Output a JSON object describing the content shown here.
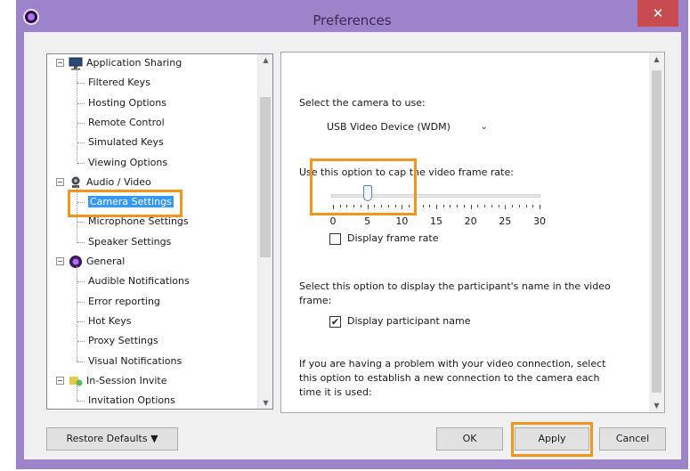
{
  "window": {
    "title": "Preferences",
    "close_glyph": "✕",
    "icon": "app-logo-icon"
  },
  "tree": {
    "items": [
      {
        "label": "Application Sharing",
        "level": 0,
        "expander": "−",
        "icon": "monitor-icon"
      },
      {
        "label": "Filtered Keys",
        "level": 1
      },
      {
        "label": "Hosting Options",
        "level": 1
      },
      {
        "label": "Remote Control",
        "level": 1
      },
      {
        "label": "Simulated Keys",
        "level": 1
      },
      {
        "label": "Viewing Options",
        "level": 1
      },
      {
        "label": "Audio / Video",
        "level": 0,
        "expander": "−",
        "icon": "webcam-icon"
      },
      {
        "label": "Camera Settings",
        "level": 1,
        "selected": true
      },
      {
        "label": "Microphone Settings",
        "level": 1
      },
      {
        "label": "Speaker Settings",
        "level": 1
      },
      {
        "label": "General",
        "level": 0,
        "expander": "−",
        "icon": "app-logo-icon"
      },
      {
        "label": "Audible Notifications",
        "level": 1
      },
      {
        "label": "Error reporting",
        "level": 1
      },
      {
        "label": "Hot Keys",
        "level": 1
      },
      {
        "label": "Proxy Settings",
        "level": 1
      },
      {
        "label": "Visual Notifications",
        "level": 1
      },
      {
        "label": "In-Session Invite",
        "level": 0,
        "expander": "−",
        "icon": "invite-icon"
      },
      {
        "label": "Invitation Options",
        "level": 1
      }
    ],
    "scroll_up": "▲",
    "scroll_down": "▼"
  },
  "panel": {
    "camera_label": "Select the camera to use:",
    "camera_value": "USB Video Device (WDM)",
    "camera_caret": "⌄",
    "framerate_label": "Use this option to cap the video frame rate:",
    "framerate_ticks": [
      "0",
      "5",
      "10",
      "15",
      "20",
      "25",
      "30"
    ],
    "framerate_value": 5,
    "display_framerate_label": "Display frame rate",
    "display_framerate_checked": false,
    "participant_desc_line1": "Select this option to display the participant's name in the video",
    "participant_desc_line2": "frame:",
    "display_participant_label": "Display participant name",
    "display_participant_checked": true,
    "check_glyph": "✔",
    "problem_line1": "If you are having a problem with your video connection, select",
    "problem_line2": "this option to establish a new connection to the camera each",
    "problem_line3": "time it is used:",
    "scroll_up": "▲",
    "scroll_down": "▼"
  },
  "buttons": {
    "restore_defaults": "Restore Defaults ▼",
    "ok": "OK",
    "apply": "Apply",
    "cancel": "Cancel"
  },
  "colors": {
    "titlebar": "#9d83ca",
    "selection": "#3399ff",
    "highlight": "#f0961e",
    "close": "#c74b50"
  }
}
